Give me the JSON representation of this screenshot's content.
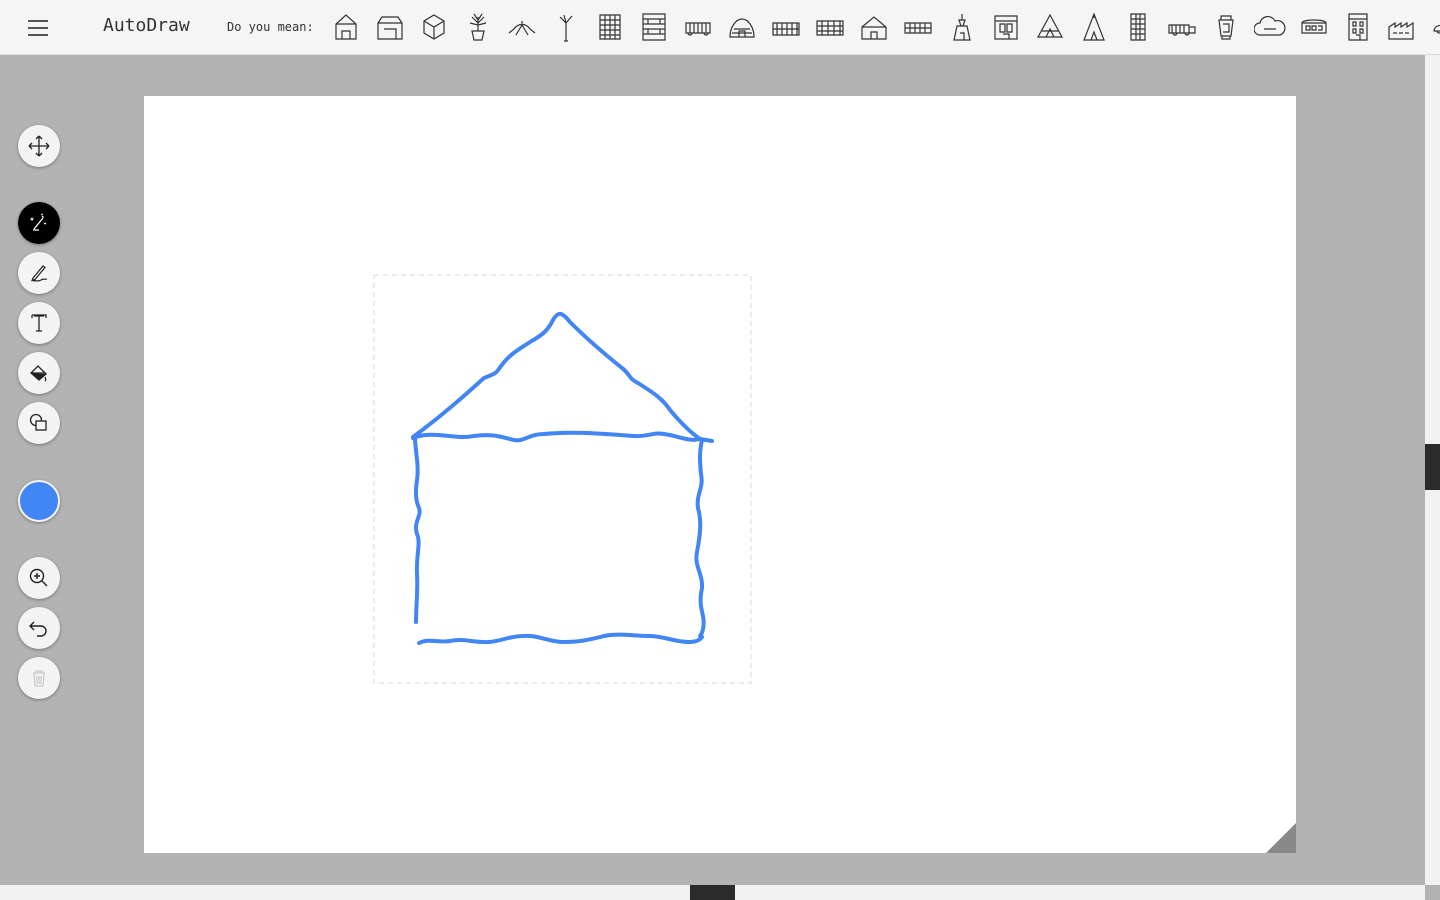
{
  "app": {
    "title": "AutoDraw",
    "suggest_label": "Do you mean:"
  },
  "suggestions": [
    {
      "name": "house-outline-icon"
    },
    {
      "name": "barn-icon"
    },
    {
      "name": "box-house-icon"
    },
    {
      "name": "potted-plant-icon"
    },
    {
      "name": "spider-icon"
    },
    {
      "name": "palm-tree-icon"
    },
    {
      "name": "tower-block-icon"
    },
    {
      "name": "apartment-building-icon"
    },
    {
      "name": "bus-icon"
    },
    {
      "name": "igloo-icon"
    },
    {
      "name": "train-car-icon"
    },
    {
      "name": "wall-icon"
    },
    {
      "name": "cottage-icon"
    },
    {
      "name": "fence-icon"
    },
    {
      "name": "church-spire-icon"
    },
    {
      "name": "storefront-icon"
    },
    {
      "name": "tent-icon"
    },
    {
      "name": "teepee-icon"
    },
    {
      "name": "tall-building-icon"
    },
    {
      "name": "truck-icon"
    },
    {
      "name": "lantern-icon"
    },
    {
      "name": "cloud-icon"
    },
    {
      "name": "tram-icon"
    },
    {
      "name": "office-building-icon"
    },
    {
      "name": "factory-icon"
    },
    {
      "name": "car-icon"
    }
  ],
  "tools": {
    "select": "move-icon",
    "autodraw": "autodraw-icon",
    "draw": "pencil-icon",
    "type": "text-icon",
    "fill": "fill-bucket-icon",
    "shape": "shapes-icon",
    "zoom": "zoom-in-icon",
    "undo": "undo-icon",
    "delete": "trash-icon"
  },
  "colors": {
    "current_stroke": "#4285f4",
    "active_tool_bg": "#000000"
  }
}
